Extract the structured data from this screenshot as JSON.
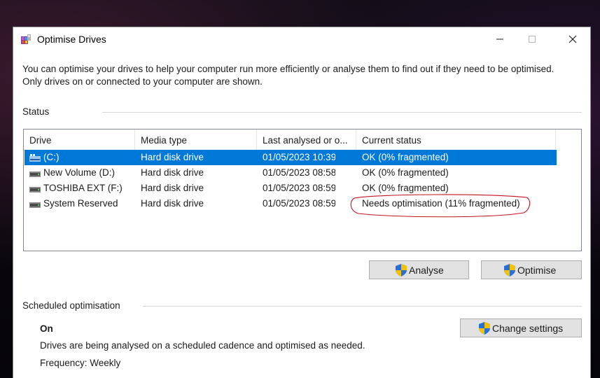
{
  "window": {
    "title": "Optimise Drives"
  },
  "intro": "You can optimise your drives to help your computer run more efficiently or analyse them to find out if they need to be optimised. Only drives on or connected to your computer are shown.",
  "status": {
    "label": "Status",
    "columns": [
      "Drive",
      "Media type",
      "Last analysed or o...",
      "Current status"
    ],
    "drives": [
      {
        "name": "(C:)",
        "media": "Hard disk drive",
        "last": "01/05/2023 10:39",
        "status": "OK (0% fragmented)",
        "selected": true
      },
      {
        "name": "New Volume (D:)",
        "media": "Hard disk drive",
        "last": "01/05/2023 08:58",
        "status": "OK (0% fragmented)",
        "selected": false
      },
      {
        "name": "TOSHIBA EXT (F:)",
        "media": "Hard disk drive",
        "last": "01/05/2023 08:59",
        "status": "OK (0% fragmented)",
        "selected": false
      },
      {
        "name": "System Reserved",
        "media": "Hard disk drive",
        "last": "01/05/2023 08:59",
        "status": "Needs optimisation (11% fragmented)",
        "selected": false
      }
    ]
  },
  "buttons": {
    "analyse": "Analyse",
    "optimise": "Optimise",
    "change_settings": "Change settings"
  },
  "scheduled": {
    "label": "Scheduled optimisation",
    "state": "On",
    "description": "Drives are being analysed on a scheduled cadence and optimised as needed.",
    "frequency": "Frequency: Weekly"
  },
  "colors": {
    "selection": "#0078d7",
    "annotation": "#c0141e",
    "shield_blue": "#2a6fd6",
    "shield_yellow": "#f2c200"
  },
  "icons": {
    "app": "optimise-drives-icon",
    "drive": "hard-drive-icon",
    "shield": "uac-shield-icon"
  }
}
